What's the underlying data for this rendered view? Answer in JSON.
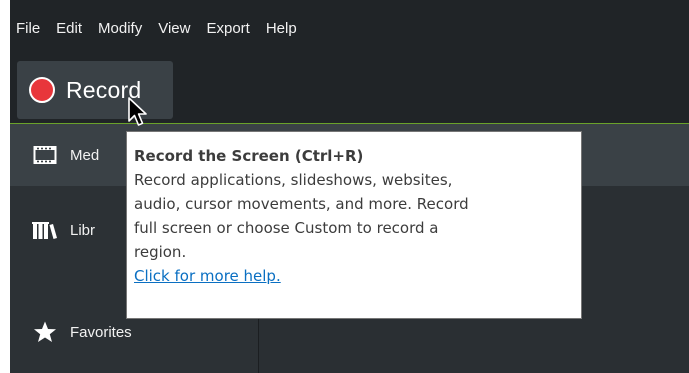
{
  "menubar": {
    "items": [
      {
        "label": "File"
      },
      {
        "label": "Edit"
      },
      {
        "label": "Modify"
      },
      {
        "label": "View"
      },
      {
        "label": "Export"
      },
      {
        "label": "Help"
      }
    ]
  },
  "toolbar": {
    "record_label": "Record",
    "record_color": "#e8363b"
  },
  "sidebar": {
    "items": [
      {
        "label": "Media",
        "visible_text": "Med",
        "icon": "film-strip-icon",
        "active": true
      },
      {
        "label": "Library",
        "visible_text": "Libr",
        "icon": "library-icon",
        "active": false
      },
      {
        "label": "Favorites",
        "visible_text": "Favorites",
        "icon": "star-icon",
        "active": false
      }
    ]
  },
  "tooltip": {
    "title": "Record the Screen (Ctrl+R)",
    "lines": [
      "Record applications, slideshows, websites,",
      "audio, cursor movements, and more. Record",
      "full screen or choose Custom to record a",
      "region."
    ],
    "link": "Click for more help."
  },
  "colors": {
    "accent_green": "#6aa22a",
    "background": "#202427",
    "link": "#0a6fc2"
  }
}
